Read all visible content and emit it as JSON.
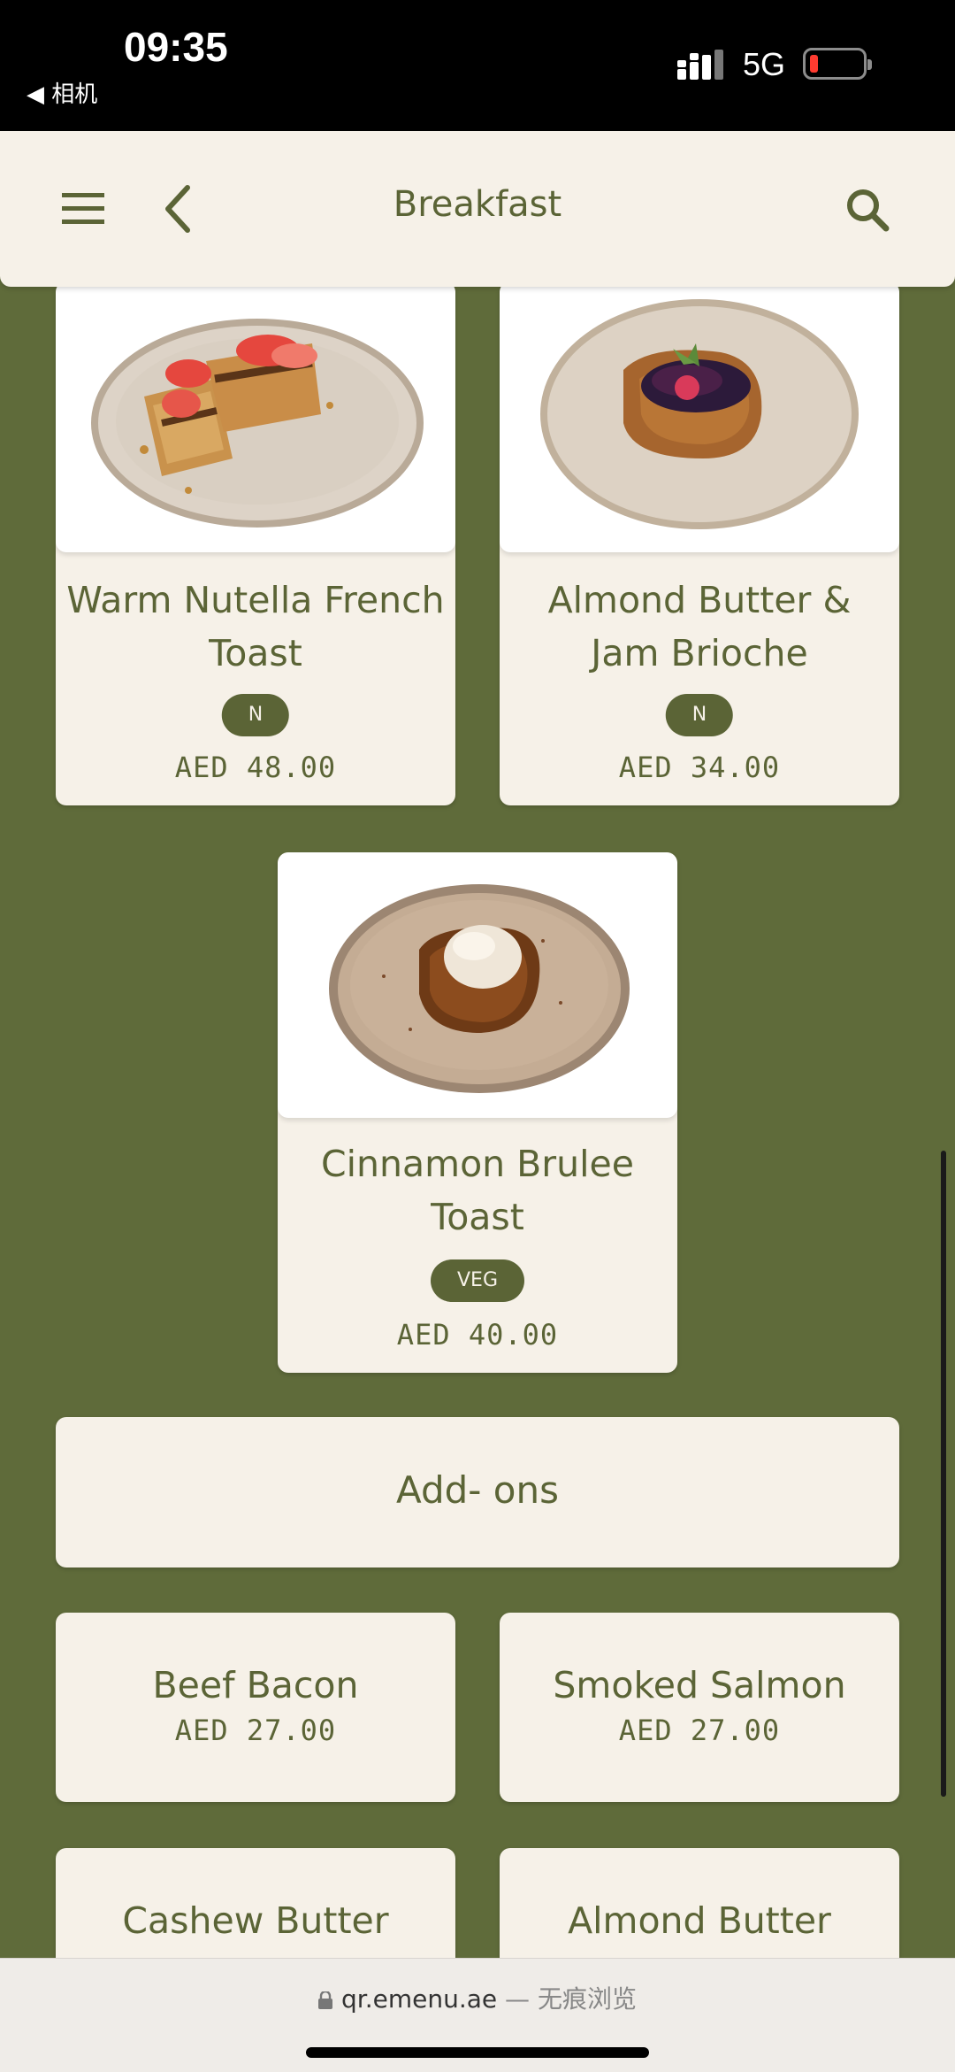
{
  "status_bar": {
    "time": "09:35",
    "back_app": "◀ 相机",
    "network": "5G"
  },
  "header": {
    "title": "Breakfast"
  },
  "menu_items": [
    {
      "name": "Warm Nutella French Toast",
      "tag": "N",
      "price": "AED 48.00"
    },
    {
      "name": "Almond Butter & Jam Brioche",
      "tag": "N",
      "price": "AED 34.00"
    },
    {
      "name": "Cinnamon Brulee Toast",
      "tag": "VEG",
      "price": "AED 40.00"
    }
  ],
  "section": {
    "title": "Add- ons"
  },
  "addons": [
    {
      "name": "Beef Bacon",
      "price": "AED 27.00"
    },
    {
      "name": "Smoked Salmon",
      "price": "AED 27.00"
    },
    {
      "name": "Cashew Butter"
    },
    {
      "name": "Almond Butter"
    }
  ],
  "browser": {
    "domain": "qr.emenu.ae",
    "mode": " — 无痕浏览"
  },
  "colors": {
    "background": "#5f6b3a",
    "card": "#f6f1e8",
    "accent": "#5b6436"
  }
}
